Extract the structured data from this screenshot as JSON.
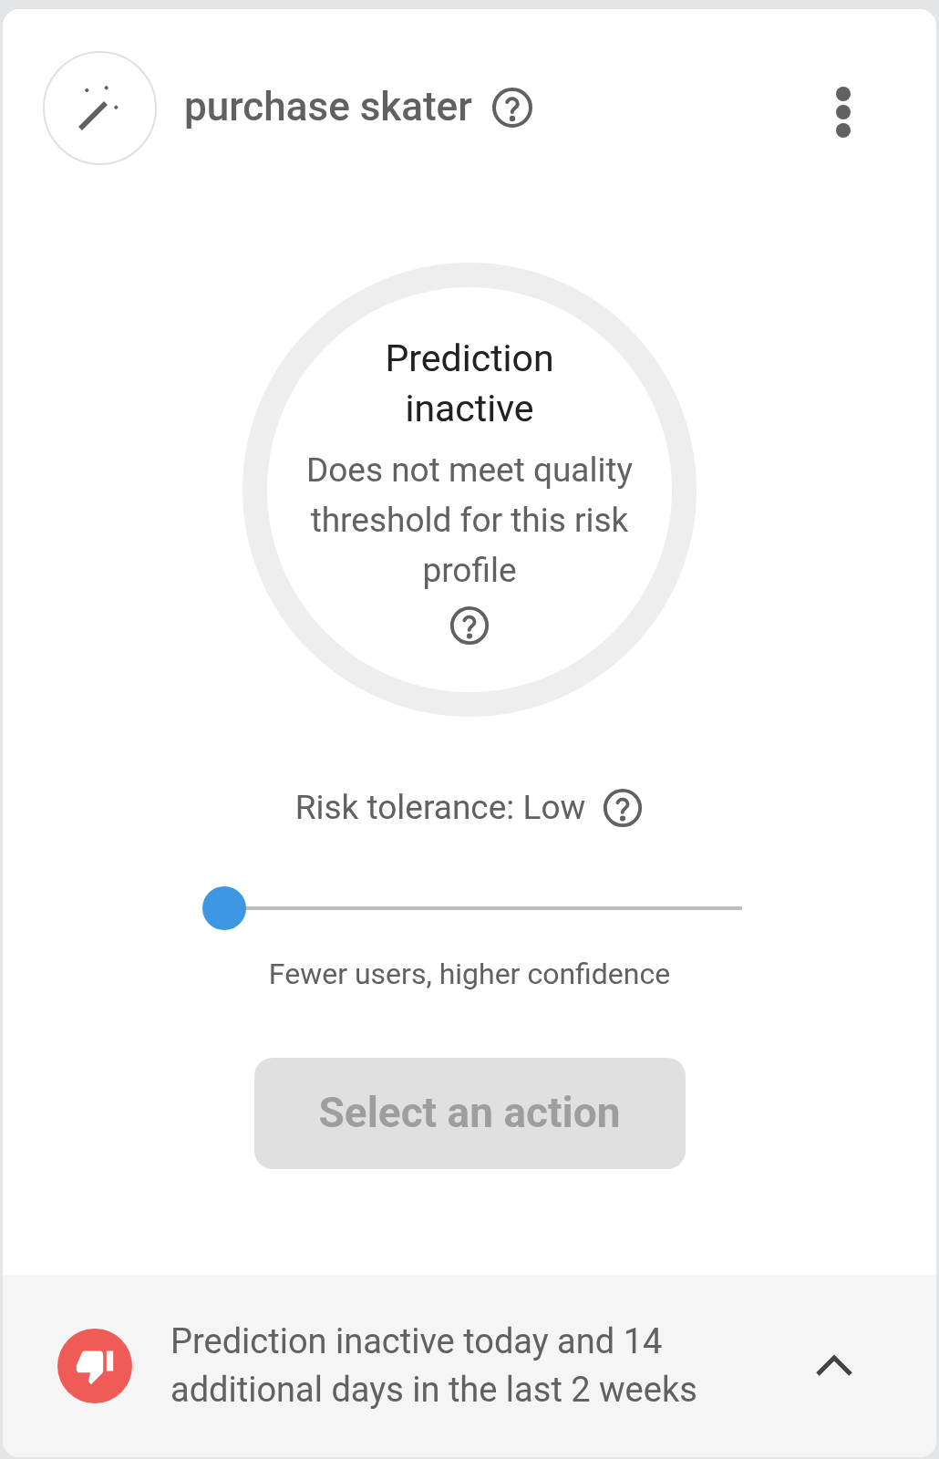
{
  "header": {
    "title": "purchase skater"
  },
  "status": {
    "title": "Prediction inactive",
    "message": "Does not meet quality threshold for this risk profile"
  },
  "risk": {
    "label": "Risk tolerance: Low",
    "level": 0,
    "caption": "Fewer users, higher confidence"
  },
  "action_button": {
    "label": "Select an action",
    "disabled": true
  },
  "footer": {
    "message": "Prediction inactive today and 14 additional days in the last 2 weeks",
    "expanded": false
  }
}
